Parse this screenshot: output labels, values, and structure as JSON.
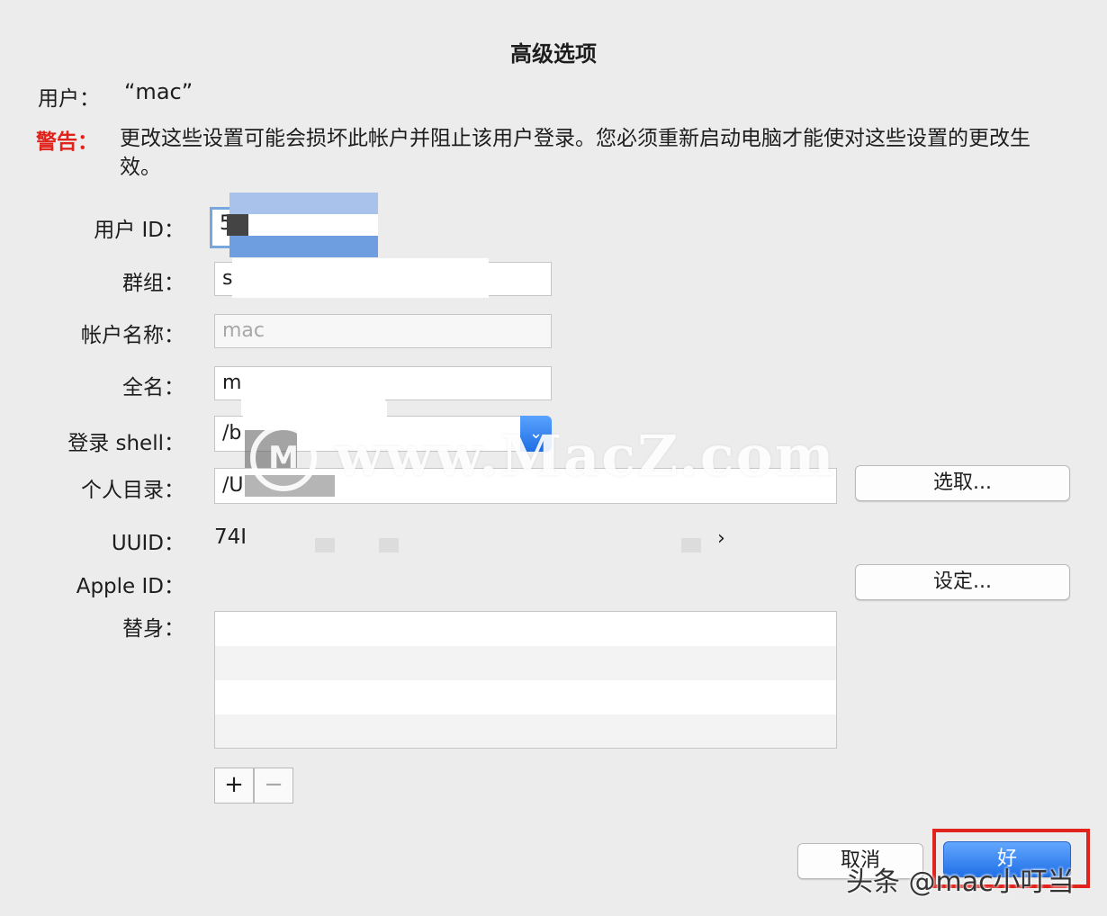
{
  "dialog": {
    "title": "高级选项",
    "user_label": "用户：",
    "user_value": "“mac”",
    "warning_label": "警告：",
    "warning_text": "更改这些设置可能会损坏此帐户并阻止该用户登录。您必须重新启动电脑才能使对这些设置的更改生效。"
  },
  "fields": {
    "user_id": {
      "label": "用户 ID：",
      "value": "5"
    },
    "group": {
      "label": "群组：",
      "value": "s"
    },
    "account_name": {
      "label": "帐户名称：",
      "placeholder": "mac"
    },
    "full_name": {
      "label": "全名：",
      "value": "m"
    },
    "login_shell": {
      "label": "登录 shell：",
      "value": "/b"
    },
    "home_dir": {
      "label": "个人目录：",
      "value": "/U"
    },
    "uuid": {
      "label": "UUID：",
      "value": "74I"
    },
    "apple_id": {
      "label": "Apple ID："
    },
    "aliases": {
      "label": "替身："
    }
  },
  "buttons": {
    "choose": "选取...",
    "set": "设定...",
    "add": "+",
    "remove": "−",
    "cancel": "取消",
    "ok": "好"
  },
  "overlay": {
    "watermark": "www.MacZ.com",
    "logo": "M",
    "corner_tag": "头条 @mac小叮当"
  },
  "colors": {
    "warning": "#e0221b",
    "accent": "#1f6fe6",
    "highlight": "#e0231c"
  }
}
